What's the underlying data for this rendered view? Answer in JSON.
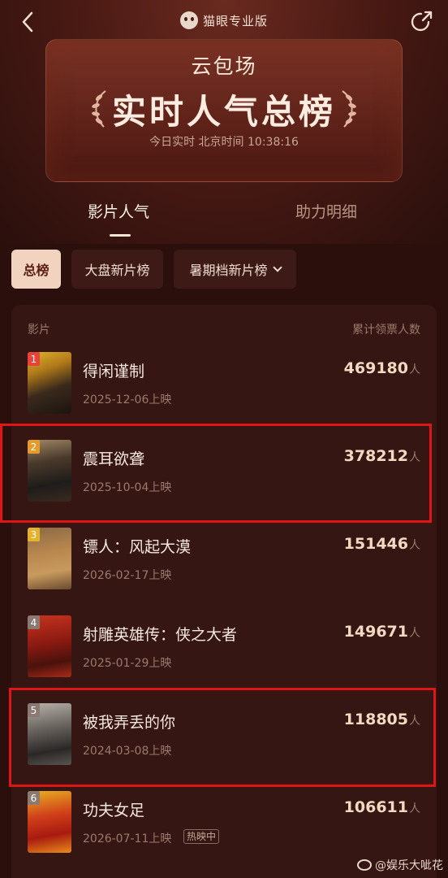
{
  "header": {
    "brand": "猫眼专业版",
    "subtitle": "云包场",
    "title": "实时人气总榜",
    "time": "今日实时 北京时间 10:38:16"
  },
  "tabs": [
    {
      "label": "影片人气",
      "active": true
    },
    {
      "label": "助力明细",
      "active": false
    }
  ],
  "filters": [
    {
      "label": "总榜",
      "active": true
    },
    {
      "label": "大盘新片榜",
      "active": false
    },
    {
      "label": "暑期档新片榜",
      "active": false
    }
  ],
  "list": {
    "col_left": "影片",
    "col_right": "累计领票人数",
    "unit": "人",
    "items": [
      {
        "rank": "1",
        "title": "得闲谨制",
        "date": "2025-12-06上映",
        "count": "469180",
        "badge": ""
      },
      {
        "rank": "2",
        "title": "震耳欲聋",
        "date": "2025-10-04上映",
        "count": "378212",
        "badge": ""
      },
      {
        "rank": "3",
        "title": "镖人：风起大漠",
        "date": "2026-02-17上映",
        "count": "151446",
        "badge": ""
      },
      {
        "rank": "4",
        "title": "射雕英雄传：侠之大者",
        "date": "2025-01-29上映",
        "count": "149671",
        "badge": ""
      },
      {
        "rank": "5",
        "title": "被我弄丢的你",
        "date": "2024-03-08上映",
        "count": "118805",
        "badge": ""
      },
      {
        "rank": "6",
        "title": "功夫女足",
        "date": "2026-07-11上映",
        "count": "106611",
        "badge": "热映中"
      }
    ]
  },
  "watermark": "@娱乐大呲花",
  "colors": {
    "background": "#2a0f0c",
    "card": "#351612",
    "highlight": "#e01515",
    "rank1": "#e8433a",
    "rank2": "#e59a2c",
    "rank3": "#e5b22c",
    "rank_other": "#8b7a72"
  }
}
